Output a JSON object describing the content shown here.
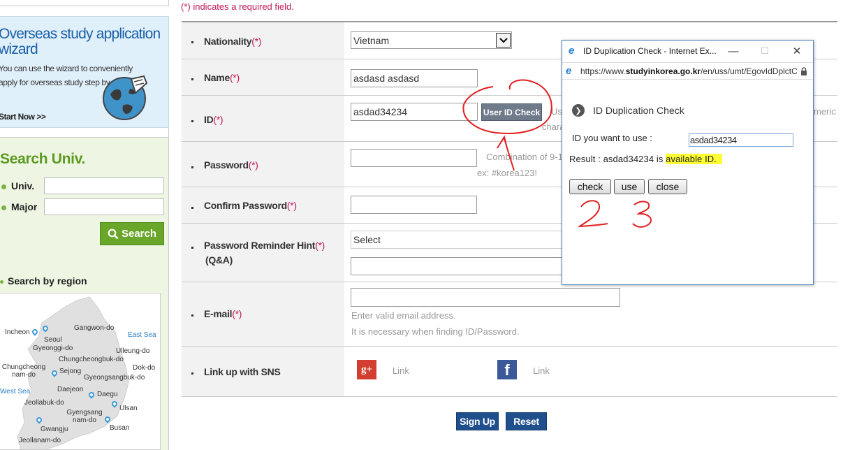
{
  "required_note": "(*) indicates a required field.",
  "sidebar": {
    "wizard": {
      "title": "Overseas study application wizard",
      "description": "You can use the wizard to conveniently apply for overseas study step by step.",
      "start_link": "Start Now >>"
    },
    "search": {
      "title": "Search Univ.",
      "univ_label": "Univ.",
      "major_label": "Major",
      "button_label": "Search"
    },
    "region": {
      "title": "Search by region",
      "labels": [
        "Incheon",
        "Seoul",
        "Gangwon-do",
        "East Sea",
        "Gyeonggi-do",
        "Ulleung-do",
        "Chungcheongbuk-do",
        "Chungcheong nam-do",
        "Sejong",
        "Dok-do",
        "Gyeongsangbuk-do",
        "West Sea",
        "Daejeon",
        "Daegu",
        "Jeollabuk-do",
        "Ulsan",
        "Gyengsang nam-do",
        "Busan",
        "Gwangju",
        "Jeollanam-do"
      ]
    }
  },
  "form": {
    "nationality": {
      "label": "Nationality",
      "required": "(*)",
      "value": "Vietnam"
    },
    "name": {
      "label": "Name",
      "required": "(*)",
      "value": "asdasd asdasd"
    },
    "id": {
      "label": "ID",
      "required": "(*)",
      "value": "asdad34234",
      "check_button": "User ID Check",
      "hint_a": "Us",
      "hint_b": "chara",
      "hint_right": "meric"
    },
    "password": {
      "label": "Password",
      "required": "(*)",
      "hint_a": "Combination of 9-1",
      "hint_b": "ex: #korea123!"
    },
    "confirm_password": {
      "label": "Confirm Password",
      "required": "(*)"
    },
    "reminder": {
      "label_a": "Password Reminder Hint",
      "required": "(*)",
      "label_b": "(Q&A)",
      "select_value": "Select"
    },
    "email": {
      "label": "E-mail",
      "required": "(*)",
      "hint_a": "Enter valid email address.",
      "hint_b": "It is necessary when finding ID/Password."
    },
    "sns": {
      "label": "Link up with SNS",
      "google_link": "Link",
      "facebook_link": "Link",
      "google_glyph": "g+",
      "facebook_glyph": "f"
    },
    "sign_up": "Sign Up",
    "reset": "Reset"
  },
  "popup": {
    "window_title": "ID Duplication Check - Internet Ex...",
    "url_prefix": "https://www.",
    "url_domain": "studyinkorea.go.kr",
    "url_path": "/en/uss/umt/EgovIdDplctC",
    "heading": "ID Duplication Check",
    "id_label": "ID you want to use :",
    "id_value": "asdad34234",
    "result_prefix": "Result  :  asdad34234 is ",
    "result_highlight": "available ID.",
    "check_button": "check",
    "use_button": "use",
    "close_button": "close"
  },
  "annotations": {
    "mark_1": "1",
    "mark_2": "2",
    "mark_3": "3",
    "ink_color": "#e02020",
    "highlight_color": "#ffff33"
  }
}
